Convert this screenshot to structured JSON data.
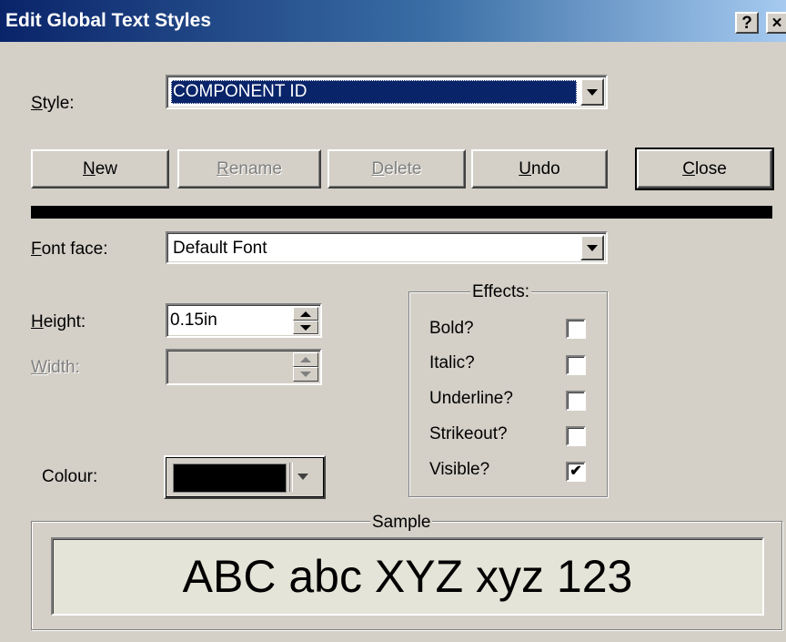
{
  "window": {
    "title": "Edit Global Text Styles",
    "help_label": "?",
    "close_label": "×"
  },
  "style": {
    "label_u": "S",
    "label_rest": "tyle:",
    "value": "COMPONENT ID"
  },
  "buttons": {
    "new_u": "N",
    "new_rest": "ew",
    "rename_u": "R",
    "rename_rest": "ename",
    "delete_u": "D",
    "delete_rest": "elete",
    "undo_u": "U",
    "undo_rest": "ndo",
    "close_u": "C",
    "close_rest": "lose"
  },
  "font_face": {
    "label_u": "F",
    "label_rest": "ont face:",
    "value": "Default Font"
  },
  "height": {
    "label_u": "H",
    "label_rest": "eight:",
    "value": "0.15in"
  },
  "width": {
    "label_u": "W",
    "label_rest": "idth:",
    "value": ""
  },
  "colour": {
    "label": "Colour:",
    "value_color": "#000000"
  },
  "effects": {
    "title": "Effects:",
    "items": [
      {
        "label": "Bold?",
        "checked": false
      },
      {
        "label": "Italic?",
        "checked": false
      },
      {
        "label": "Underline?",
        "checked": false
      },
      {
        "label": "Strikeout?",
        "checked": false
      },
      {
        "label": "Visible?",
        "checked": true
      }
    ]
  },
  "sample": {
    "title": "Sample",
    "text": "ABC abc XYZ xyz 123"
  },
  "colors": {
    "face": "#d4d0c8",
    "selection": "#0a246a",
    "sample_bg": "#e4e4d8"
  }
}
